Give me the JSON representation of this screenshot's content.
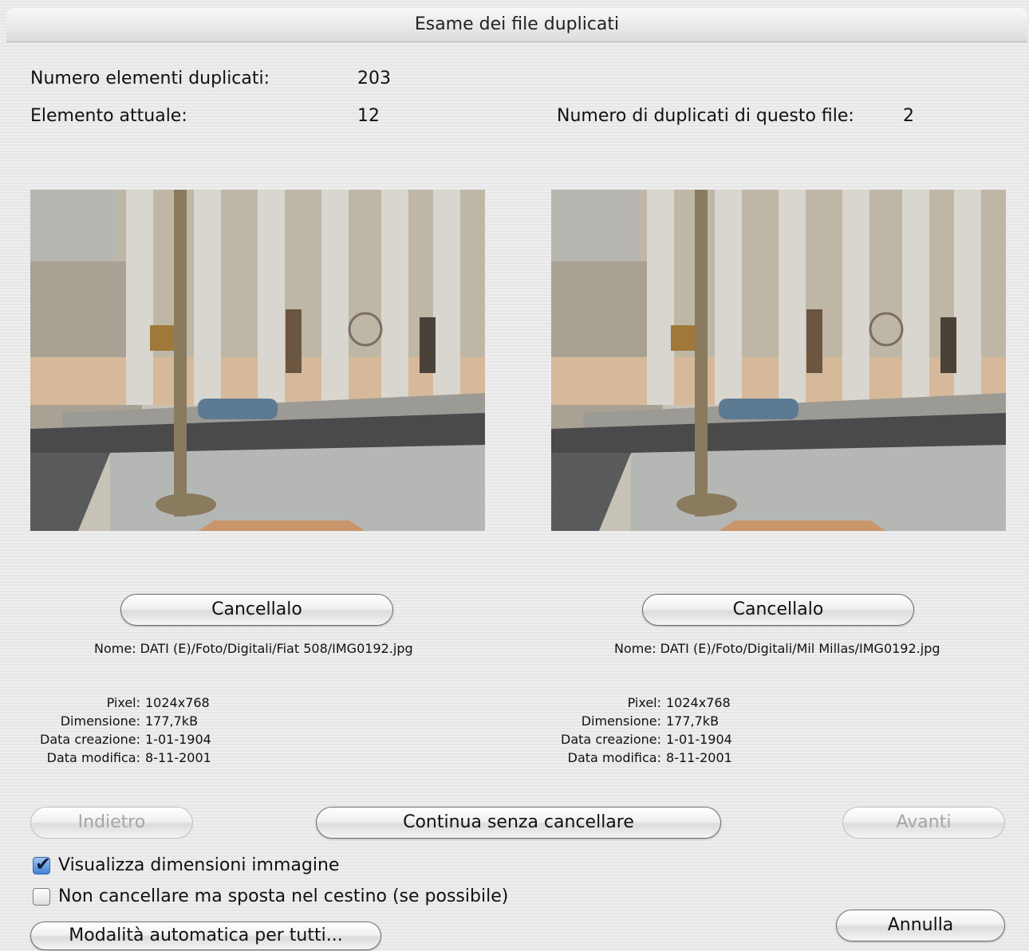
{
  "window": {
    "title": "Esame dei file duplicati"
  },
  "stats": {
    "count_label": "Numero elementi duplicati:",
    "count_value": "203",
    "current_label": "Elemento attuale:",
    "current_value": "12",
    "dup_label": "Numero di duplicati di questo file:",
    "dup_value": "2"
  },
  "left": {
    "delete_label": "Cancellalo",
    "name": "Nome: DATI (E)/Foto/Digitali/Fiat 508/IMG0192.jpg",
    "meta": [
      {
        "key": "Pixel:",
        "value": "1024x768"
      },
      {
        "key": "Dimensione:",
        "value": "177,7kB"
      },
      {
        "key": "Data creazione:",
        "value": "1-01-1904"
      },
      {
        "key": "Data modifica:",
        "value": "8-11-2001"
      }
    ]
  },
  "right": {
    "delete_label": "Cancellalo",
    "name": "Nome: DATI (E)/Foto/Digitali/Mil Millas/IMG0192.jpg",
    "meta": [
      {
        "key": "Pixel:",
        "value": "1024x768"
      },
      {
        "key": "Dimensione:",
        "value": "177,7kB"
      },
      {
        "key": "Data creazione:",
        "value": "1-01-1904"
      },
      {
        "key": "Data modifica:",
        "value": "8-11-2001"
      }
    ]
  },
  "nav": {
    "back_label": "Indietro",
    "continue_label": "Continua senza cancellare",
    "next_label": "Avanti"
  },
  "options": {
    "show_size_label": "Visualizza dimensioni immagine",
    "show_size_checked": true,
    "trash_label": "Non cancellare ma sposta nel cestino (se possibile)",
    "trash_checked": false
  },
  "footer": {
    "auto_label": "Modalità automatica per tutti...",
    "cancel_label": "Annulla"
  }
}
